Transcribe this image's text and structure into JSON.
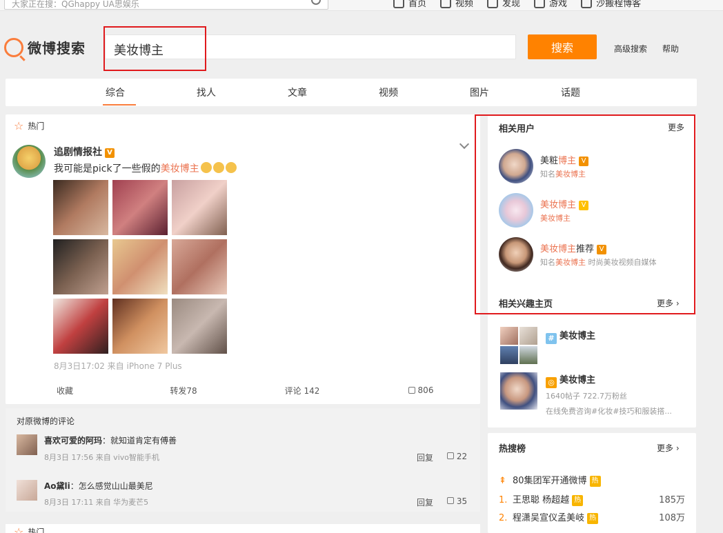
{
  "topbar": {
    "search_placeholder": "大家正在搜：QGhappy UA思娱乐",
    "nav": [
      "首页",
      "视频",
      "发现",
      "游戏",
      "沙搬程博客"
    ]
  },
  "header": {
    "logo_text": "微博搜索",
    "query": "美妆博主",
    "search_button": "搜索",
    "advanced": "高级搜索",
    "help": "帮助"
  },
  "tabs": [
    "综合",
    "找人",
    "文章",
    "视频",
    "图片",
    "话题"
  ],
  "post": {
    "section_label": "热门",
    "user": "追剧情报社",
    "text_before": "我可能是pick了一些假的",
    "text_highlight": "美妆博主",
    "meta": "8月3日17:02 来自 iPhone 7 Plus",
    "actions": {
      "collect": "收藏",
      "repost": "转发78",
      "comment": "评论 142",
      "like": "806"
    }
  },
  "comments": {
    "title": "对原微博的评论",
    "items": [
      {
        "name": "喜欢可爱的阿玛",
        "sep": "：",
        "text": "就知道肯定有傅善",
        "meta": "8月3日 17:56 来自 vivo智能手机",
        "reply": "回复",
        "likes": "22"
      },
      {
        "name": "Ao黛li",
        "sep": "：",
        "text": "怎么感觉山山最美尼",
        "meta": "8月3日 17:11 来自 华为麦芒5",
        "reply": "回复",
        "likes": "35"
      }
    ]
  },
  "next_section_label": "热门",
  "related_users": {
    "title": "相关用户",
    "more": "更多",
    "items": [
      {
        "name_plain": "美粧",
        "name_hl": "博主",
        "desc_prefix": "知名",
        "desc_hl": "美妆博主",
        "desc_suffix": ""
      },
      {
        "name_plain": "",
        "name_hl": "美妆博主",
        "desc_prefix": "",
        "desc_hl": "美妆博主",
        "desc_suffix": ""
      },
      {
        "name_plain": "推荐",
        "name_hl": "美妆博主",
        "desc_prefix": "知名",
        "desc_hl": "美妆博主",
        "desc_suffix": " 时尚美妆视频自媒体"
      }
    ]
  },
  "interest": {
    "title": "相关兴趣主页",
    "more": "更多",
    "items": [
      {
        "name": "美妆博主",
        "stats": "",
        "desc": ""
      },
      {
        "name": "美妆博主",
        "stats": "1640帖子 722.7万粉丝",
        "desc": "在线免费咨询#化妆#技巧和服装搭..."
      }
    ]
  },
  "hotlist": {
    "title": "热搜榜",
    "more": "更多",
    "hot_tag": "热",
    "items": [
      {
        "rank": "",
        "text": "80集团军开通微博",
        "count": ""
      },
      {
        "rank": "1.",
        "text": "王思聪 杨超越",
        "count": "185万"
      },
      {
        "rank": "2.",
        "text": "程潇吴宣仪孟美岐",
        "count": "108万"
      }
    ]
  },
  "colors": {
    "accent": "#ff8200",
    "highlight": "#eb7350",
    "annotation": "#e0191c"
  }
}
